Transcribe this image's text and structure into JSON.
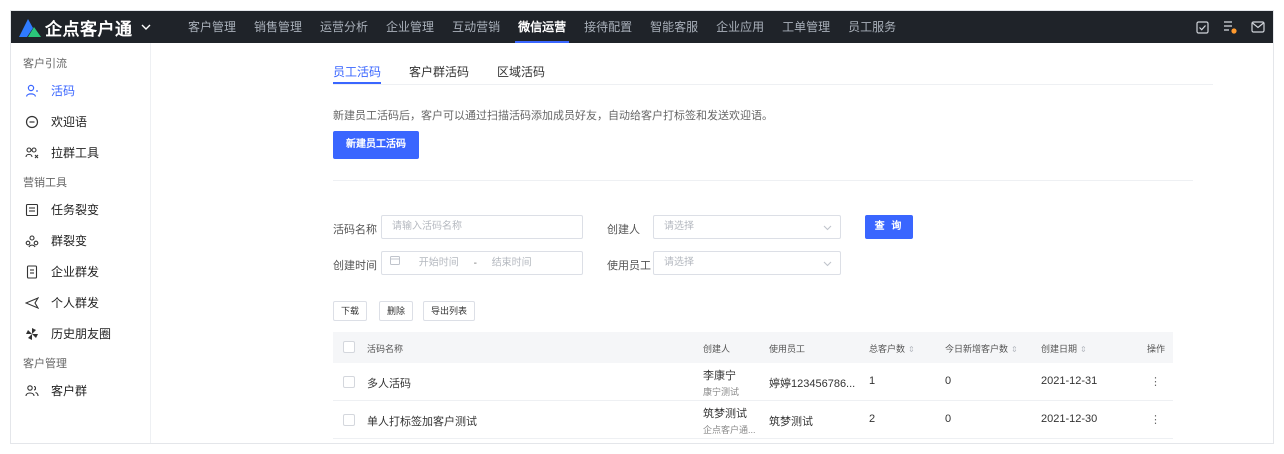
{
  "topbar": {
    "app_name": "企点客户通",
    "nav": [
      "客户管理",
      "销售管理",
      "运营分析",
      "企业管理",
      "互动营销",
      "微信运营",
      "接待配置",
      "智能客服",
      "企业应用",
      "工单管理",
      "员工服务"
    ],
    "active_nav": "微信运营",
    "icons": [
      "checkbox-icon",
      "task-list-icon",
      "mail-icon"
    ]
  },
  "sidebar": {
    "group_lead": "客户引流",
    "lead_items": [
      {
        "label": "活码",
        "icon": "person-code-icon",
        "active": true
      },
      {
        "label": "欢迎语",
        "icon": "chat-bubble-icon"
      },
      {
        "label": "拉群工具",
        "icon": "group-add-icon"
      }
    ],
    "group_marketing": "营销工具",
    "marketing_items": [
      {
        "label": "任务裂变",
        "icon": "task-icon"
      },
      {
        "label": "群裂变",
        "icon": "group-split-icon"
      },
      {
        "label": "企业群发",
        "icon": "document-icon"
      },
      {
        "label": "个人群发",
        "icon": "send-icon"
      },
      {
        "label": "历史朋友圈",
        "icon": "pinwheel-icon"
      }
    ],
    "group_customer": "客户管理",
    "customer_items": [
      {
        "label": "客户群",
        "icon": "customer-group-icon"
      }
    ]
  },
  "tabs": [
    "员工活码",
    "客户群活码",
    "区域活码"
  ],
  "description": "新建员工活码后，客户可以通过扫描活码添加成员好友，自动给客户打标签和发送欢迎语。",
  "new_button": "新建员工活码",
  "filters": {
    "code_name_label": "活码名称",
    "code_name_placeholder": "请输入活码名称",
    "creator_label": "创建人",
    "creator_placeholder": "请选择",
    "query_button": "查 询",
    "created_time_label": "创建时间",
    "start_placeholder": "开始时间",
    "range_sep": "-",
    "end_placeholder": "结束时间",
    "staff_label": "使用员工",
    "staff_placeholder": "请选择"
  },
  "actions": [
    "下载",
    "删除",
    "导出列表"
  ],
  "table": {
    "columns": [
      "活码名称",
      "创建人",
      "使用员工",
      "总客户数",
      "今日新增客户数",
      "创建日期",
      "操作"
    ],
    "rows": [
      {
        "name": "多人活码",
        "creator": "李康宁",
        "creator_sub": "康宁测试",
        "staff": "婷婷123456786...",
        "total": "1",
        "today": "0",
        "date": "2021-12-31",
        "op": "⋮"
      },
      {
        "name": "单人打标签加客户测试",
        "creator": "筑梦测试",
        "creator_sub": "企点客户通...",
        "staff": "筑梦测试",
        "total": "2",
        "today": "0",
        "date": "2021-12-30",
        "op": "⋮"
      }
    ]
  },
  "colors": {
    "accent": "#3a66ff",
    "topbar": "#1f2329",
    "logo_green": "#2bc77b",
    "logo_blue": "#2f7bff"
  }
}
